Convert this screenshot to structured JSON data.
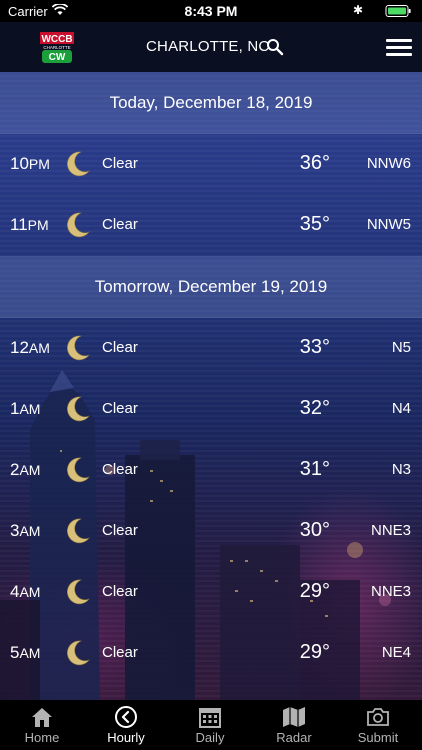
{
  "status_bar": {
    "carrier": "Carrier",
    "time": "8:43 PM"
  },
  "header": {
    "logo": {
      "text_top": "WCCB",
      "text_mid": "CHARLOTTE",
      "text_bottom": "CW"
    },
    "location": "CHARLOTTE, NC"
  },
  "days": [
    {
      "header": "Today, December 18, 2019",
      "hours": [
        {
          "hour": "10",
          "ampm": "PM",
          "icon": "moon-icon",
          "condition": "Clear",
          "temp": "36°",
          "wind": "NNW6"
        },
        {
          "hour": "11",
          "ampm": "PM",
          "icon": "moon-icon",
          "condition": "Clear",
          "temp": "35°",
          "wind": "NNW5"
        }
      ]
    },
    {
      "header": "Tomorrow, December 19, 2019",
      "hours": [
        {
          "hour": "12",
          "ampm": "AM",
          "icon": "moon-icon",
          "condition": "Clear",
          "temp": "33°",
          "wind": "N5"
        },
        {
          "hour": "1",
          "ampm": "AM",
          "icon": "moon-icon",
          "condition": "Clear",
          "temp": "32°",
          "wind": "N4"
        },
        {
          "hour": "2",
          "ampm": "AM",
          "icon": "moon-icon",
          "condition": "Clear",
          "temp": "31°",
          "wind": "N3"
        },
        {
          "hour": "3",
          "ampm": "AM",
          "icon": "moon-icon",
          "condition": "Clear",
          "temp": "30°",
          "wind": "NNE3"
        },
        {
          "hour": "4",
          "ampm": "AM",
          "icon": "moon-icon",
          "condition": "Clear",
          "temp": "29°",
          "wind": "NNE3"
        },
        {
          "hour": "5",
          "ampm": "AM",
          "icon": "moon-icon",
          "condition": "Clear",
          "temp": "29°",
          "wind": "NE4"
        }
      ]
    }
  ],
  "tabs": [
    {
      "label": "Home",
      "icon": "home-icon",
      "active": false
    },
    {
      "label": "Hourly",
      "icon": "clock-icon",
      "active": true
    },
    {
      "label": "Daily",
      "icon": "calendar-icon",
      "active": false
    },
    {
      "label": "Radar",
      "icon": "map-icon",
      "active": false
    },
    {
      "label": "Submit",
      "icon": "camera-icon",
      "active": false
    }
  ],
  "colors": {
    "moon": "#d8c07a",
    "accent_band": "#2a3b8a",
    "tabbar": "#000000"
  }
}
